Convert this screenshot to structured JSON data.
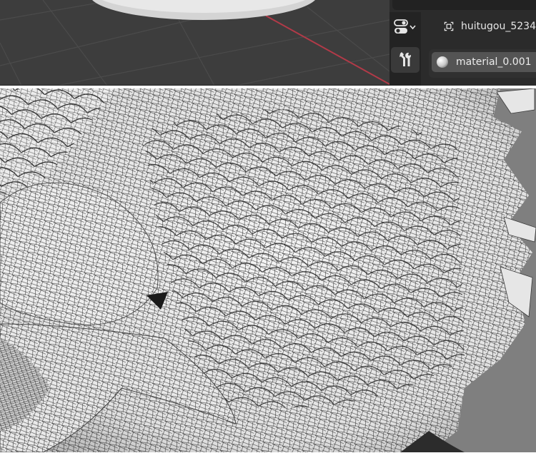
{
  "properties": {
    "object_name": "huitugou_5234",
    "material_name": "material_0.001",
    "tabs": [
      {
        "name": "display-mode",
        "icon": "toggle-switches-icon"
      },
      {
        "name": "tool",
        "icon": "wrench-screwdriver-icon"
      }
    ],
    "object_icon": "object-bounds-icon",
    "material_icon": "material-sphere-icon"
  },
  "viewport": {
    "background": "#3d3d3d",
    "grid_color": "#4a4a4a",
    "x_axis_color": "#b23a48",
    "disc_color": "#e2e2e2"
  },
  "render": {
    "mesh_color": "#efefef",
    "wire_color": "#202020",
    "background": "#7f7f7f"
  }
}
